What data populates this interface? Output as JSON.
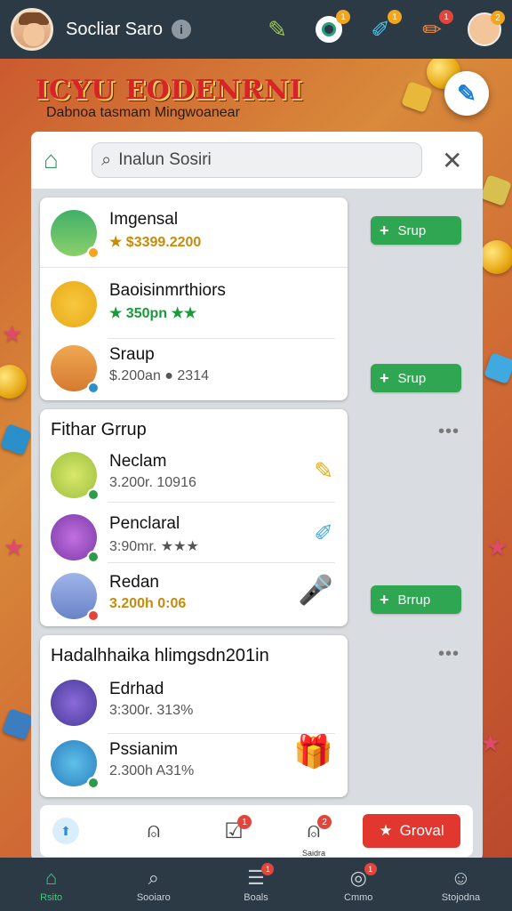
{
  "topbar": {
    "title": "Socliar Saro",
    "info_icon": "info-icon",
    "badges": {
      "chat": "1",
      "marker": "1",
      "brush": "1",
      "profile": "2"
    }
  },
  "banner": {
    "title": "ICYU EODENRNI",
    "subtitle": "Dabnoa tasmam Mingwoanear"
  },
  "search": {
    "placeholder": "Inalun Sosiri",
    "value": "Inalun Sosiri"
  },
  "top_list": [
    {
      "name": "Imgensal",
      "sub": "★ $3399.2200",
      "button": "Srup"
    },
    {
      "name": "Baoisinmrthiors",
      "sub": "★ 350pn ★★"
    },
    {
      "name": "Sraup",
      "sub": "$.200an ● 2314",
      "button": "Srup"
    }
  ],
  "section1": {
    "title": "Fithar Grrup",
    "items": [
      {
        "name": "Neclam",
        "sub": "3.200r. 10916"
      },
      {
        "name": "Penclaral",
        "sub": "3:90mr. ★★★"
      },
      {
        "name": "Redan",
        "sub": "3.200h 0:06",
        "button": "Brrup"
      }
    ]
  },
  "section2": {
    "title": "Hadalhhaika hlimgsdn201in",
    "items": [
      {
        "name": "Edrhad",
        "sub": "3:300r. 313%"
      },
      {
        "name": "Pssianim",
        "sub": "2.300h A31%"
      }
    ]
  },
  "action_bar": {
    "tab_label": "Saidra",
    "goal_label": "Groval",
    "badges": {
      "check": "1",
      "people": "2"
    }
  },
  "bottom_nav": [
    {
      "label": "Rsito",
      "icon": "home-icon"
    },
    {
      "label": "Sooiaro",
      "icon": "search-icon"
    },
    {
      "label": "Boals",
      "icon": "list-icon",
      "badge": "1"
    },
    {
      "label": "Cmmo",
      "icon": "compass-icon",
      "badge": "1"
    },
    {
      "label": "Stojodna",
      "icon": "person-icon"
    }
  ],
  "colors": {
    "accent_green": "#2fa652",
    "goal_red": "#e2372f",
    "topbar": "#2b3a45"
  }
}
